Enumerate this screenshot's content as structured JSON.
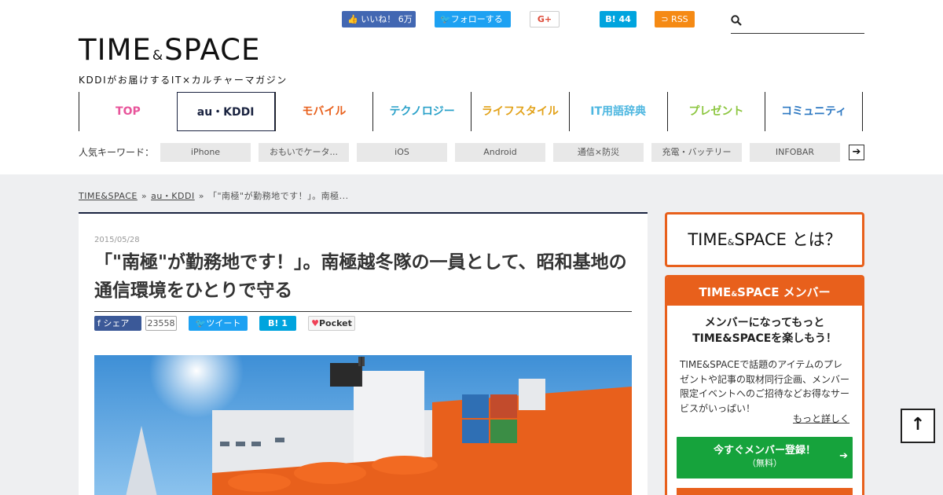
{
  "header": {
    "logo_main": "TIME",
    "logo_amp": "&",
    "logo_main2": "SPACE",
    "logo_sub": "KDDIがお届けするIT×カルチャーマガジン",
    "social": {
      "fb_like": "いいね！ 6万",
      "tw_follow": "フォローする",
      "gplus": "G+",
      "hatena": "B! 44",
      "rss": "RSS"
    },
    "search": {
      "value": "",
      "placeholder": ""
    }
  },
  "nav": {
    "items": [
      {
        "label": "TOP",
        "color": "#e8559b"
      },
      {
        "label": "au・KDDI",
        "color": "#1a2340"
      },
      {
        "label": "モバイル",
        "color": "#e8601c"
      },
      {
        "label": "テクノロジー",
        "color": "#2aa1c9"
      },
      {
        "label": "ライフスタイル",
        "color": "#e2a21a"
      },
      {
        "label": "IT用語辞典",
        "color": "#4cb6e0"
      },
      {
        "label": "プレゼント",
        "color": "#8cc63f"
      },
      {
        "label": "コミュニティ",
        "color": "#2d78c2"
      }
    ]
  },
  "keywords": {
    "label": "人気キーワード：",
    "items": [
      "iPhone",
      "おもいでケータ...",
      "iOS",
      "Android",
      "通信×防災",
      "充電・バッテリー",
      "INFOBAR"
    ],
    "more": "➔"
  },
  "breadcrumb": {
    "home": "TIME&SPACE",
    "category": "au・KDDI",
    "current": "「\"南極\"が勤務地です！」。南極...",
    "separator": "»"
  },
  "article": {
    "date": "2015/05/28",
    "title": "「\"南極\"が勤務地です！」。南極越冬隊の一員として、昭和基地の通信環境をひとりで守る",
    "share": {
      "fb_label": "シェア",
      "fb_count": "23558",
      "tw_label": "ツイート",
      "hatena_label": "B!  1",
      "pocket_label": "Pocket"
    }
  },
  "sidebar": {
    "about": {
      "text1": "TIME",
      "amp": "&",
      "text2": "SPACE とは？"
    },
    "member": {
      "head1": "TIME",
      "head_amp": "&",
      "head2": "SPACE メンバー",
      "catch_line1": "メンバーになってもっと",
      "catch_line2": "TIME&SPACEを楽しもう！",
      "desc": "TIME&SPACEで話題のアイテムのプレゼントや記事の取材同行企画、メンバー限定イベントへのご招待などお得なサービスがいっぱい！",
      "more": "もっと詳しく",
      "cta_main": "今すぐメンバー登録！",
      "cta_sub": "（無料）",
      "cta_arrow": "➔"
    }
  },
  "pagetop": {
    "label": "↑"
  },
  "colors": {
    "accent": "#e8601c",
    "navy": "#1a2340",
    "cta_green": "#16a33c"
  }
}
